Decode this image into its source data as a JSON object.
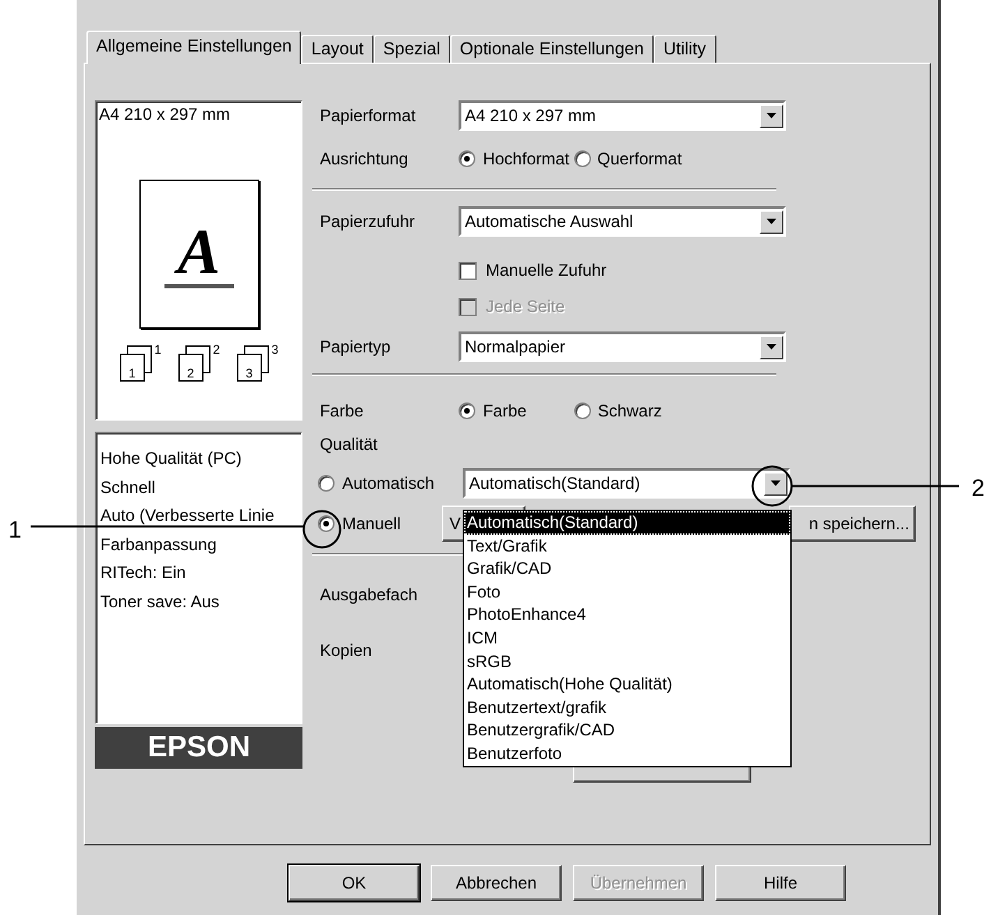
{
  "tabs": [
    {
      "label": "Allgemeine Einstellungen",
      "selected": true
    },
    {
      "label": "Layout",
      "selected": false
    },
    {
      "label": "Spezial",
      "selected": false
    },
    {
      "label": "Optionale Einstellungen",
      "selected": false
    },
    {
      "label": "Utility",
      "selected": false
    }
  ],
  "preview": {
    "paper_label": "A4 210 x 297 mm",
    "letter": "A",
    "page_icons": [
      {
        "front": "1",
        "back": "1"
      },
      {
        "front": "2",
        "back": "2"
      },
      {
        "front": "3",
        "back": "3"
      }
    ]
  },
  "summary": [
    "Hohe Qualität (PC)",
    "Schnell",
    "Auto (Verbesserte Linie",
    "Farbanpassung",
    "RITech: Ein",
    "Toner save: Aus"
  ],
  "logo": "EPSON",
  "rows": [
    {
      "kind": "combo",
      "label": "Papierformat",
      "value": "A4 210 x 297 mm"
    },
    {
      "kind": "radios",
      "label": "Ausrichtung",
      "options": [
        {
          "label": "Hochformat",
          "selected": true
        },
        {
          "label": "Querformat",
          "selected": false
        }
      ]
    },
    {
      "kind": "separator"
    },
    {
      "kind": "combo",
      "label": "Papierzufuhr",
      "value": "Automatische Auswahl"
    },
    {
      "kind": "checkbox",
      "label": "Manuelle Zufuhr",
      "checked": false,
      "disabled": false
    },
    {
      "kind": "checkbox",
      "label": "Jede Seite",
      "checked": false,
      "disabled": true
    },
    {
      "kind": "combo",
      "label": "Papiertyp",
      "value": "Normalpapier"
    },
    {
      "kind": "separator"
    },
    {
      "kind": "radios",
      "label": "Farbe",
      "options": [
        {
          "label": "Farbe",
          "selected": true
        },
        {
          "label": "Schwarz",
          "selected": false
        }
      ]
    },
    {
      "kind": "heading",
      "label": "Qualität"
    },
    {
      "kind": "radio_combo",
      "option": "Automatisch",
      "selected": false,
      "value": "Automatisch(Standard)"
    },
    {
      "kind": "radio_buttons",
      "option": "Manuell",
      "selected": true,
      "buttons": [
        "V",
        "n speichern..."
      ]
    },
    {
      "kind": "separator"
    },
    {
      "kind": "heading",
      "label": "Ausgabefach"
    },
    {
      "kind": "heading",
      "label": "Kopien"
    },
    {
      "kind": "button_stub"
    }
  ],
  "dropdown": [
    {
      "label": "Automatisch(Standard)",
      "selected": true
    },
    {
      "label": "Text/Grafik",
      "selected": false
    },
    {
      "label": "Grafik/CAD",
      "selected": false
    },
    {
      "label": "Foto",
      "selected": false
    },
    {
      "label": "PhotoEnhance4",
      "selected": false
    },
    {
      "label": "ICM",
      "selected": false
    },
    {
      "label": "sRGB",
      "selected": false
    },
    {
      "label": "Automatisch(Hohe Qualität)",
      "selected": false
    },
    {
      "label": "Benutzertext/grafik",
      "selected": false
    },
    {
      "label": "Benutzergrafik/CAD",
      "selected": false
    },
    {
      "label": "Benutzerfoto",
      "selected": false
    }
  ],
  "buttons": [
    {
      "label": "OK",
      "disabled": false,
      "default": true
    },
    {
      "label": "Abbrechen",
      "disabled": false,
      "default": false
    },
    {
      "label": "Übernehmen",
      "disabled": true,
      "default": false
    },
    {
      "label": "Hilfe",
      "disabled": false,
      "default": false
    }
  ],
  "callouts": [
    {
      "label": "1"
    },
    {
      "label": "2"
    }
  ]
}
